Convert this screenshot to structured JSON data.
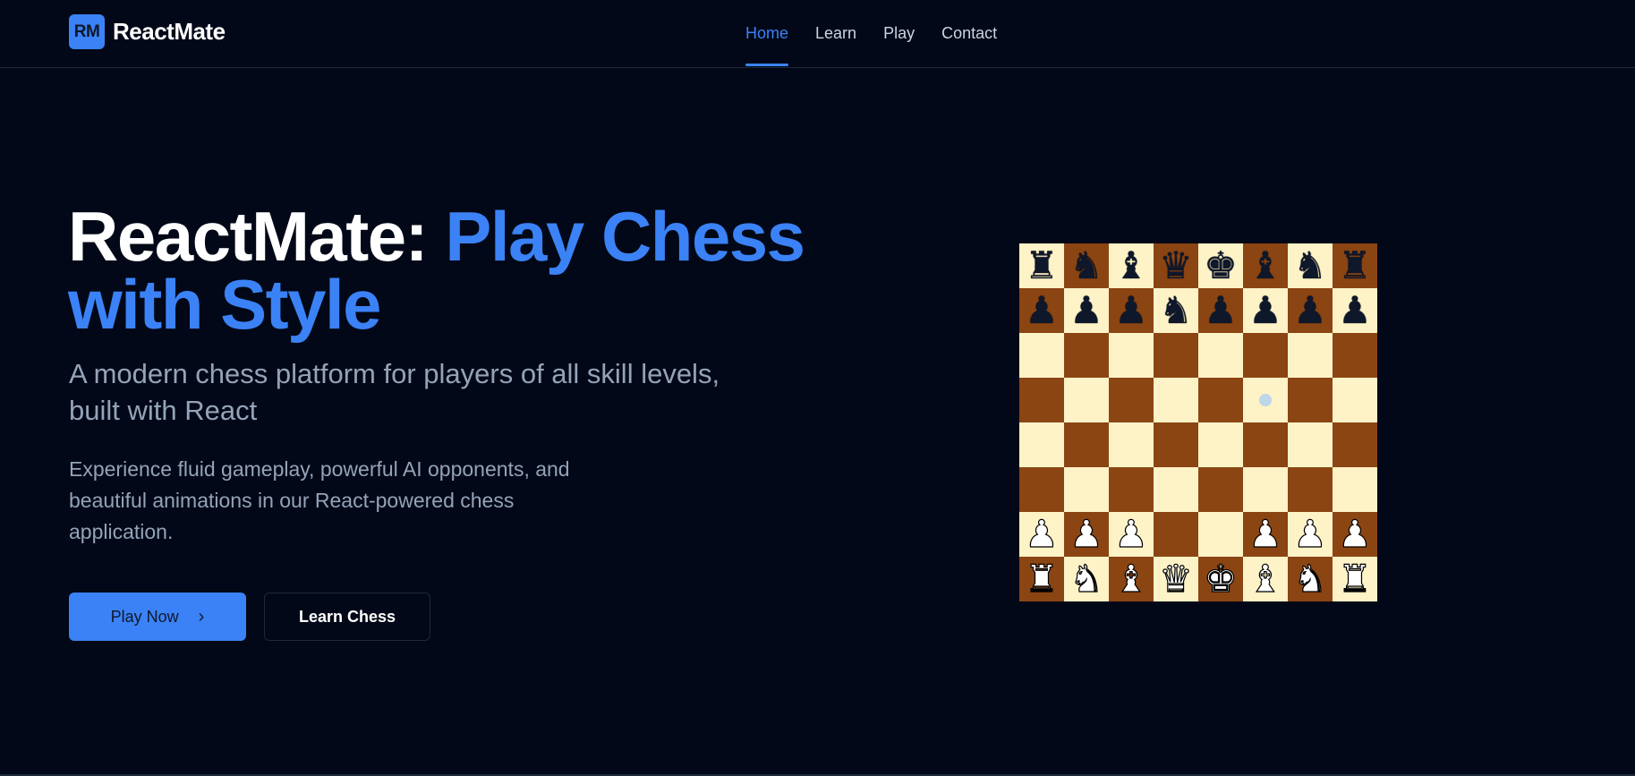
{
  "brand": {
    "badge": "RM",
    "name": "ReactMate"
  },
  "nav": {
    "items": [
      {
        "label": "Home",
        "active": true
      },
      {
        "label": "Learn",
        "active": false
      },
      {
        "label": "Play",
        "active": false
      },
      {
        "label": "Contact",
        "active": false
      }
    ]
  },
  "hero": {
    "title_main": "ReactMate: ",
    "title_accent": "Play Chess with Style",
    "subtitle": "A modern chess platform for players of all skill levels, built with React",
    "description": "Experience fluid gameplay, powerful AI opponents, and beautiful animations in our React-powered chess application.",
    "primary_button": "Play Now",
    "secondary_button": "Learn Chess"
  },
  "board": {
    "ranks": [
      [
        "bR",
        "bN",
        "bB",
        "bQ",
        "bK",
        "bB",
        "bN",
        "bR"
      ],
      [
        "bP",
        "bP",
        "bP",
        "bN",
        "bP",
        "bP",
        "bP",
        "bP"
      ],
      [
        "",
        "",
        "",
        "",
        "",
        "",
        "",
        ""
      ],
      [
        "",
        "",
        "",
        "",
        "",
        "hint",
        "",
        ""
      ],
      [
        "",
        "",
        "",
        "",
        "",
        "",
        "",
        ""
      ],
      [
        "",
        "",
        "",
        "",
        "",
        "",
        "",
        ""
      ],
      [
        "wP",
        "wP",
        "wP",
        "",
        "",
        "wP",
        "wP",
        "wP"
      ],
      [
        "wR",
        "wN",
        "wB",
        "wQ",
        "wK",
        "wB",
        "wN",
        "wR"
      ]
    ]
  },
  "colors": {
    "background": "#020817",
    "accent": "#3b82f6",
    "muted_text": "#94a3b8",
    "board_light": "#fdf3c7",
    "board_dark": "#8b4513"
  }
}
